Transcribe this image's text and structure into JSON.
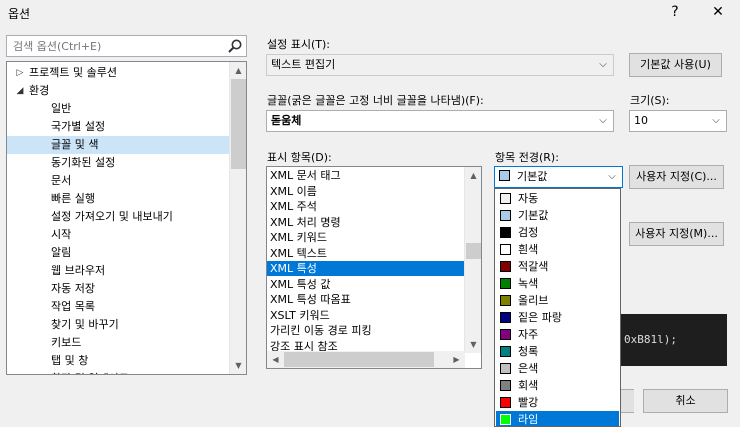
{
  "window": {
    "title": "옵션",
    "help_label": "?",
    "close_label": "✕"
  },
  "search": {
    "placeholder": "검색 옵션(Ctrl+E)"
  },
  "tree": {
    "items": [
      {
        "label": "프로젝트 및 솔루션",
        "level": 0,
        "arrow": "▷"
      },
      {
        "label": "환경",
        "level": 0,
        "arrow": "◢"
      },
      {
        "label": "일반",
        "level": 1
      },
      {
        "label": "국가별 설정",
        "level": 1
      },
      {
        "label": "글꼴 및 색",
        "level": 1,
        "selected": true
      },
      {
        "label": "동기화된 설정",
        "level": 1
      },
      {
        "label": "문서",
        "level": 1
      },
      {
        "label": "빠른 실행",
        "level": 1
      },
      {
        "label": "설정 가져오기 및 내보내기",
        "level": 1
      },
      {
        "label": "시작",
        "level": 1
      },
      {
        "label": "알림",
        "level": 1
      },
      {
        "label": "웹 브라우저",
        "level": 1
      },
      {
        "label": "자동 저장",
        "level": 1
      },
      {
        "label": "작업 목록",
        "level": 1
      },
      {
        "label": "찾기 및 바꾸기",
        "level": 1
      },
      {
        "label": "키보드",
        "level": 1
      },
      {
        "label": "탭 및 창",
        "level": 1
      },
      {
        "label": "확장 및 업데이트",
        "level": 1
      }
    ]
  },
  "show_settings": {
    "label": "설정 표시(T):",
    "value": "텍스트 편집기",
    "reset_label": "기본값 사용(U)"
  },
  "font": {
    "label": "글꼴(굵은 글꼴은 고정 너비 글꼴을 나타냄)(F):",
    "value": "돋움체"
  },
  "size": {
    "label": "크기(S):",
    "value": "10"
  },
  "display_items": {
    "label": "표시 항목(D):",
    "items": [
      "XML 문서 태그",
      "XML 이름",
      "XML 주석",
      "XML 처리 명령",
      "XML 키워드",
      "XML 텍스트",
      "XML 특성",
      "XML 특성 값",
      "XML 특성 따옴표",
      "XSLT 키워드",
      "가리킨 이동 경로 피킹",
      "강조 표시 참조"
    ],
    "selected_index": 6
  },
  "foreground": {
    "label": "항목 전경(R):",
    "value": "기본값",
    "value_color": "#aacbe8",
    "custom_label": "사용자 지정(C)...",
    "options": [
      {
        "label": "자동",
        "color": "#f0f0f0"
      },
      {
        "label": "기본값",
        "color": "#aacbe8"
      },
      {
        "label": "검정",
        "color": "#000000"
      },
      {
        "label": "흰색",
        "color": "#ffffff"
      },
      {
        "label": "적갈색",
        "color": "#800000"
      },
      {
        "label": "녹색",
        "color": "#008000"
      },
      {
        "label": "올리브",
        "color": "#808000"
      },
      {
        "label": "짙은 파랑",
        "color": "#000080"
      },
      {
        "label": "자주",
        "color": "#800080"
      },
      {
        "label": "청록",
        "color": "#008080"
      },
      {
        "label": "은색",
        "color": "#c0c0c0"
      },
      {
        "label": "회색",
        "color": "#808080"
      },
      {
        "label": "빨강",
        "color": "#ff0000"
      },
      {
        "label": "라임",
        "color": "#00ff00",
        "selected": true
      }
    ]
  },
  "background": {
    "custom_label": "사용자 지정(M)..."
  },
  "preview": {
    "text": "0xB81l);"
  },
  "footer": {
    "cancel_label": "취소"
  }
}
